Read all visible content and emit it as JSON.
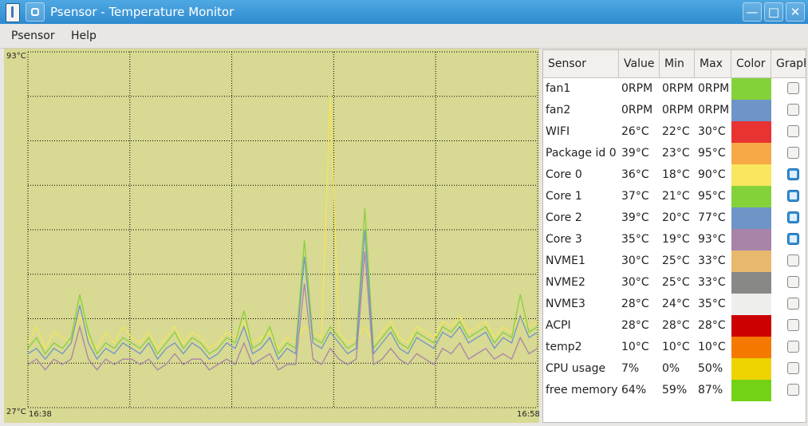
{
  "window": {
    "title": "Psensor - Temperature Monitor",
    "buttons": {
      "minimize": "—",
      "maximize": "□",
      "close": "✕"
    }
  },
  "menu": [
    {
      "label": "Psensor"
    },
    {
      "label": "Help"
    }
  ],
  "graph": {
    "y_max_label": "93°C",
    "y_min_label": "27°C",
    "x_start_label": "16:38",
    "x_end_label": "16:58",
    "background": "#d8d992",
    "grid_color": "#000000"
  },
  "chart_data": {
    "type": "line",
    "ylim": [
      27,
      93
    ],
    "xlim": [
      "16:38",
      "16:58"
    ],
    "x_ticks": [
      "16:38",
      "16:58"
    ],
    "y_ticks": [
      "27°C",
      "93°C"
    ],
    "grid": true,
    "series": [
      {
        "color": "#f2e65a",
        "values": [
          39,
          42,
          38,
          41,
          40,
          39,
          44,
          40,
          38,
          41,
          39,
          42,
          40,
          39,
          41,
          38,
          40,
          42,
          39,
          41,
          40,
          38,
          39,
          41,
          40,
          43,
          39,
          40,
          41,
          38,
          40,
          39,
          42,
          41,
          40,
          85,
          41,
          39,
          40,
          42,
          39,
          41,
          43,
          40,
          39,
          42,
          41,
          40,
          43,
          42,
          44,
          41,
          42,
          43,
          40,
          42,
          41,
          44,
          42,
          43
        ]
      },
      {
        "color": "#84d23a",
        "values": [
          38,
          40,
          37,
          39,
          38,
          40,
          48,
          41,
          37,
          39,
          38,
          40,
          39,
          38,
          40,
          37,
          39,
          41,
          38,
          40,
          39,
          37,
          38,
          40,
          39,
          45,
          38,
          39,
          42,
          37,
          39,
          38,
          58,
          40,
          39,
          42,
          40,
          38,
          39,
          64,
          38,
          40,
          42,
          39,
          38,
          41,
          40,
          39,
          42,
          41,
          43,
          40,
          41,
          42,
          39,
          41,
          40,
          48,
          41,
          42
        ]
      },
      {
        "color": "#6f95c7",
        "values": [
          37,
          38,
          36,
          38,
          37,
          39,
          46,
          39,
          36,
          38,
          37,
          39,
          38,
          37,
          39,
          36,
          38,
          39,
          37,
          39,
          38,
          36,
          37,
          39,
          38,
          42,
          37,
          38,
          40,
          36,
          38,
          37,
          55,
          39,
          38,
          41,
          39,
          37,
          38,
          60,
          37,
          39,
          41,
          38,
          37,
          40,
          39,
          38,
          41,
          40,
          42,
          39,
          40,
          41,
          38,
          40,
          39,
          44,
          40,
          41
        ]
      },
      {
        "color": "#a883aa",
        "values": [
          35,
          36,
          34,
          36,
          35,
          36,
          42,
          36,
          34,
          36,
          35,
          36,
          36,
          35,
          36,
          34,
          35,
          37,
          35,
          36,
          36,
          34,
          35,
          36,
          35,
          39,
          35,
          36,
          37,
          34,
          35,
          35,
          50,
          36,
          35,
          38,
          36,
          35,
          36,
          56,
          35,
          36,
          38,
          36,
          35,
          37,
          36,
          35,
          38,
          37,
          39,
          36,
          37,
          38,
          36,
          37,
          36,
          40,
          37,
          38
        ]
      }
    ]
  },
  "table": {
    "headers": [
      "Sensor",
      "Value",
      "Min",
      "Max",
      "Color",
      "Graph"
    ],
    "rows": [
      {
        "sensor": "fan1",
        "value": "0RPM",
        "min": "0RPM",
        "max": "0RPM",
        "color": "#84d23a",
        "graph": false
      },
      {
        "sensor": "fan2",
        "value": "0RPM",
        "min": "0RPM",
        "max": "0RPM",
        "color": "#6f95c7",
        "graph": false
      },
      {
        "sensor": "WIFI",
        "value": "26°C",
        "min": "22°C",
        "max": "30°C",
        "color": "#e93232",
        "graph": false
      },
      {
        "sensor": "Package id 0",
        "value": "39°C",
        "min": "23°C",
        "max": "95°C",
        "color": "#f7a947",
        "graph": false
      },
      {
        "sensor": "Core 0",
        "value": "36°C",
        "min": "18°C",
        "max": "90°C",
        "color": "#f9e65c",
        "graph": true
      },
      {
        "sensor": "Core 1",
        "value": "37°C",
        "min": "21°C",
        "max": "95°C",
        "color": "#84d23a",
        "graph": true
      },
      {
        "sensor": "Core 2",
        "value": "39°C",
        "min": "20°C",
        "max": "77°C",
        "color": "#6f95c7",
        "graph": true
      },
      {
        "sensor": "Core 3",
        "value": "35°C",
        "min": "19°C",
        "max": "93°C",
        "color": "#a883aa",
        "graph": true
      },
      {
        "sensor": "NVME1",
        "value": "30°C",
        "min": "25°C",
        "max": "33°C",
        "color": "#e8b86e",
        "graph": false
      },
      {
        "sensor": "NVME2",
        "value": "30°C",
        "min": "25°C",
        "max": "33°C",
        "color": "#888886",
        "graph": false
      },
      {
        "sensor": "NVME3",
        "value": "28°C",
        "min": "24°C",
        "max": "35°C",
        "color": "#eeeeec",
        "graph": false
      },
      {
        "sensor": "ACPI",
        "value": "28°C",
        "min": "28°C",
        "max": "28°C",
        "color": "#cc0000",
        "graph": false
      },
      {
        "sensor": "temp2",
        "value": "10°C",
        "min": "10°C",
        "max": "10°C",
        "color": "#f57900",
        "graph": false
      },
      {
        "sensor": "CPU usage",
        "value": "7%",
        "min": "0%",
        "max": "50%",
        "color": "#edd400",
        "graph": false
      },
      {
        "sensor": "free memory",
        "value": "64%",
        "min": "59%",
        "max": "87%",
        "color": "#73d216",
        "graph": false
      }
    ]
  }
}
